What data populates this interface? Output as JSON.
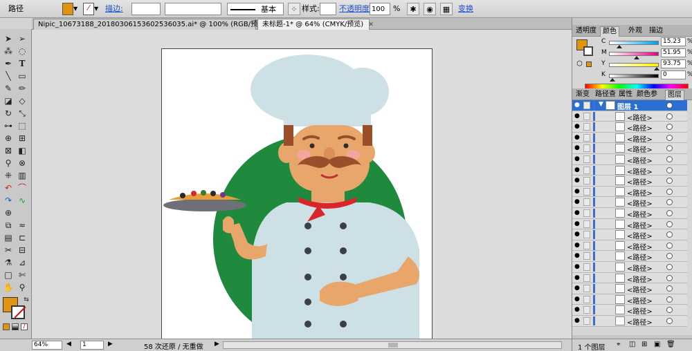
{
  "control_bar": {
    "selection_label": "路径",
    "fill_color": "#e0930f",
    "stroke_label": "描边:",
    "brush_label": "基本",
    "style_label": "样式:",
    "opacity_label": "不透明度:",
    "opacity_value": "100",
    "opacity_unit": "%",
    "transform_label": "变换"
  },
  "doc_tabs": [
    {
      "label": "Nipic_10673188_20180306153602536035.ai* @ 100% (RGB/预览)",
      "active": false
    },
    {
      "label": "未标题-1* @ 64% (CMYK/预览)",
      "active": true
    }
  ],
  "color_panel": {
    "tabs": [
      "透明度",
      "颜色",
      "外观",
      "描边"
    ],
    "active_tab": "颜色",
    "swatch_color": "#e0930f",
    "channels": [
      {
        "label": "C",
        "value": "15.23",
        "fraction": 0.1523,
        "gradient": [
          "#ffffff",
          "#00a0e9"
        ]
      },
      {
        "label": "M",
        "value": "51.95",
        "fraction": 0.5195,
        "gradient": [
          "#ffffff",
          "#e4007f"
        ]
      },
      {
        "label": "Y",
        "value": "93.75",
        "fraction": 0.9375,
        "gradient": [
          "#ffffff",
          "#fff100"
        ]
      },
      {
        "label": "K",
        "value": "0",
        "fraction": 0.0,
        "gradient": [
          "#ffffff",
          "#000000"
        ]
      }
    ],
    "unit": "%"
  },
  "layers_panel": {
    "tabs": [
      "渐变",
      "路径查",
      "属性",
      "颜色参",
      "图层"
    ],
    "active_tab": "图层",
    "layer_name": "图层 1",
    "path_label": "<路径>",
    "path_count": 20,
    "footer_count": "1 个图层"
  },
  "status_bar": {
    "zoom": "64%",
    "artboard": "1",
    "history": "58 次还原 / 无重做"
  },
  "illustration_colors": {
    "green": "#1f8a3d",
    "hat": "#cde0e6",
    "skin": "#e9a66b",
    "hair": "#9a4f2a",
    "scarf": "#d8262b",
    "button": "#3a3f4a",
    "plate": "#6e6f77"
  }
}
